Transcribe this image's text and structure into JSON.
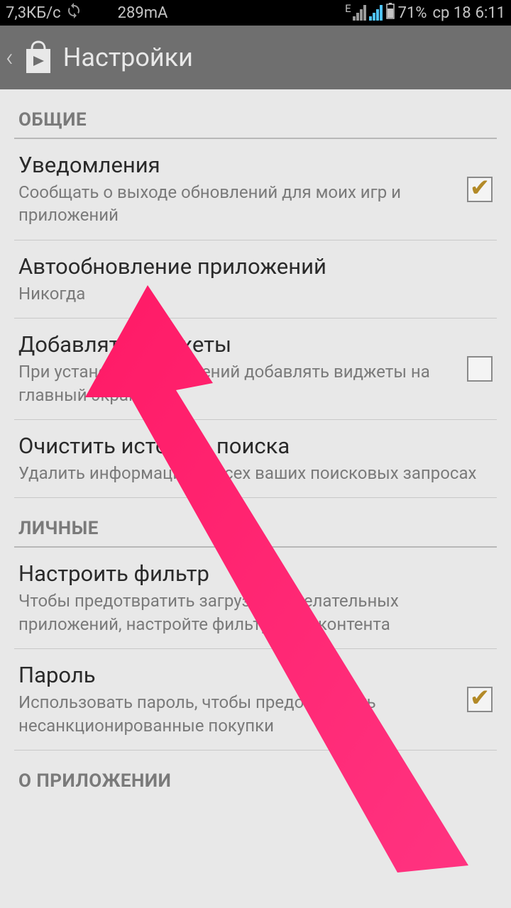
{
  "status": {
    "speed": "7,3КБ/с",
    "current": "289mA",
    "edge": "E",
    "battery": "71%",
    "date": "ср 18",
    "time": "6:11"
  },
  "appbar": {
    "title": "Настройки"
  },
  "sections": {
    "general": "ОБЩИЕ",
    "personal": "ЛИЧНЫЕ",
    "about": "О ПРИЛОЖЕНИИ"
  },
  "settings": {
    "notifications": {
      "title": "Уведомления",
      "sub": "Сообщать о выходе обновлений для моих игр и приложений"
    },
    "autoupdate": {
      "title": "Автообновление приложений",
      "sub": "Никогда"
    },
    "widgets": {
      "title": "Добавлять виджеты",
      "sub": "При установке приложений добавлять виджеты на главный экран"
    },
    "clearhistory": {
      "title": "Очистить историю поиска",
      "sub": "Удалить информацию о всех ваших поисковых запросах"
    },
    "filter": {
      "title": "Настроить фильтр",
      "sub": "Чтобы предотвратить загрузку нежелательных приложений, настройте фильтрацию контента"
    },
    "password": {
      "title": "Пароль",
      "sub": "Использовать пароль, чтобы предотвратить несанкционированные покупки"
    }
  }
}
